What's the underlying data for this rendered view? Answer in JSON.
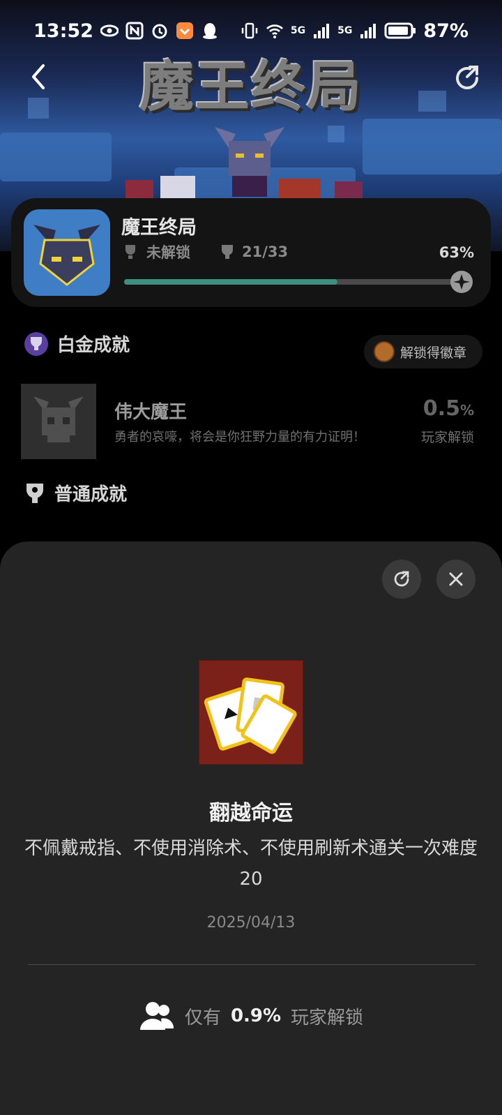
{
  "status_bar": {
    "time": "13:52",
    "battery": "87%",
    "network_1": "5G",
    "network_2": "5G"
  },
  "header": {
    "logo_text": "魔王终局"
  },
  "game": {
    "title": "魔王终局",
    "platinum_status": "未解锁",
    "trophy_count": "21/33",
    "progress_percent_text": "63%",
    "progress_fraction": 0.63
  },
  "platinum_section": {
    "title": "白金成就",
    "badge_button": "解锁得徽章"
  },
  "platinum_achievement": {
    "name": "伟大魔王",
    "description": "勇者的哀嚎，将会是你狂野力量的有力证明！",
    "rate_value": "0.5",
    "rate_unit": "%",
    "rate_label": "玩家解锁"
  },
  "normal_section": {
    "title": "普通成就"
  },
  "detail": {
    "name": "翻越命运",
    "description": "不佩戴戒指、不使用消除术、不使用刷新术通关一次难度20",
    "date": "2025/04/13",
    "stat_prefix": "仅有",
    "stat_value": "0.9%",
    "stat_suffix": "玩家解锁"
  },
  "colors": {
    "accent_progress": "#3e8f7f",
    "sheet_bg": "#242424",
    "card_bg": "#141414"
  }
}
